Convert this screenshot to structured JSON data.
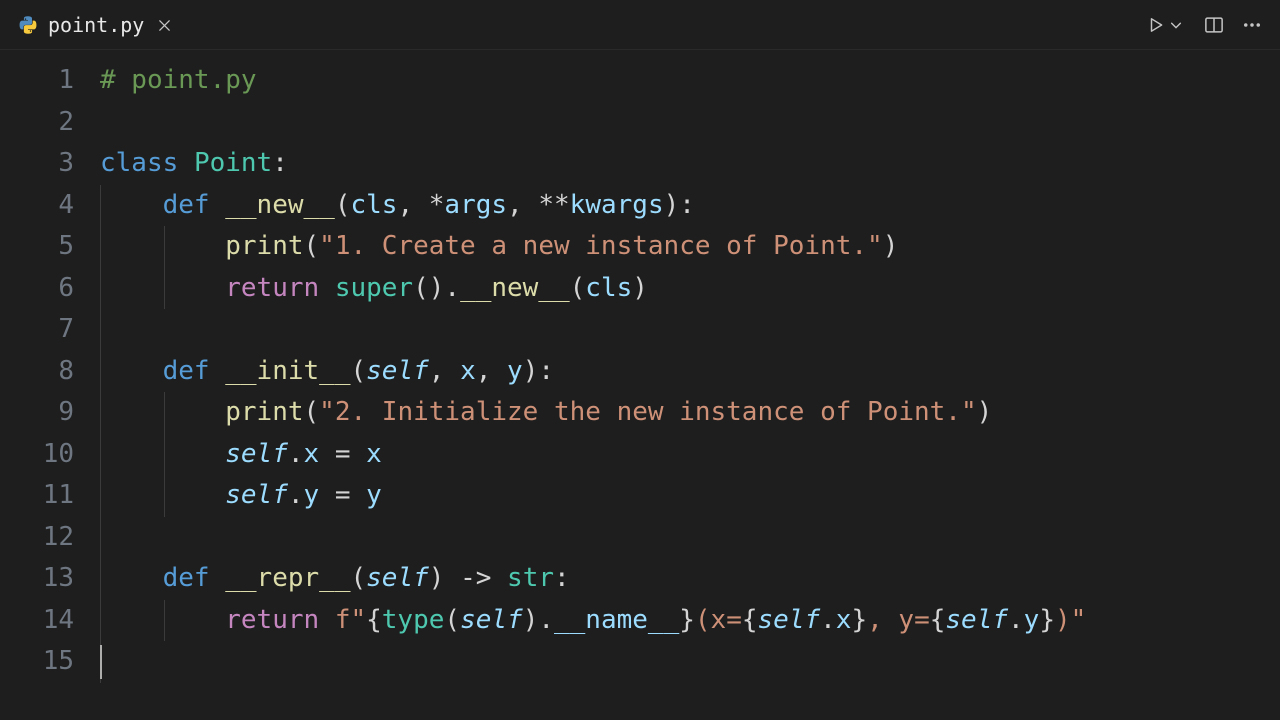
{
  "tab": {
    "filename": "point.py",
    "icon": "python-file-icon"
  },
  "actions": {
    "run": "run-icon",
    "run_menu": "chevron-down-icon",
    "split": "split-editor-icon",
    "more": "more-icon"
  },
  "code": {
    "line_count": 15,
    "lines": {
      "l1_comment": "# point.py",
      "l3_class": "class",
      "l3_name": "Point",
      "l4_def": "def",
      "l4_name": "__new__",
      "l4_cls": "cls",
      "l4_args": "args",
      "l4_kwargs": "kwargs",
      "l5_print": "print",
      "l5_str": "\"1. Create a new instance of Point.\"",
      "l6_return": "return",
      "l6_super": "super",
      "l6_new": "__new__",
      "l6_cls": "cls",
      "l8_def": "def",
      "l8_name": "__init__",
      "l8_self": "self",
      "l8_x": "x",
      "l8_y": "y",
      "l9_print": "print",
      "l9_str": "\"2. Initialize the new instance of Point.\"",
      "l10_self": "self",
      "l10_attr": "x",
      "l10_eq": " = ",
      "l10_rhs": "x",
      "l11_self": "self",
      "l11_attr": "y",
      "l11_eq": " = ",
      "l11_rhs": "y",
      "l13_def": "def",
      "l13_name": "__repr__",
      "l13_self": "self",
      "l13_arrow": " -> ",
      "l13_ret": "str",
      "l14_return": "return",
      "l14_str_a": "f\"",
      "l14_type": "type",
      "l14_self1": "self",
      "l14_nameattr": "__name__",
      "l14_mid1": "(x=",
      "l14_self2": "self",
      "l14_x": "x",
      "l14_mid2": ", y=",
      "l14_self3": "self",
      "l14_y": "y",
      "l14_tail": ")\""
    }
  }
}
